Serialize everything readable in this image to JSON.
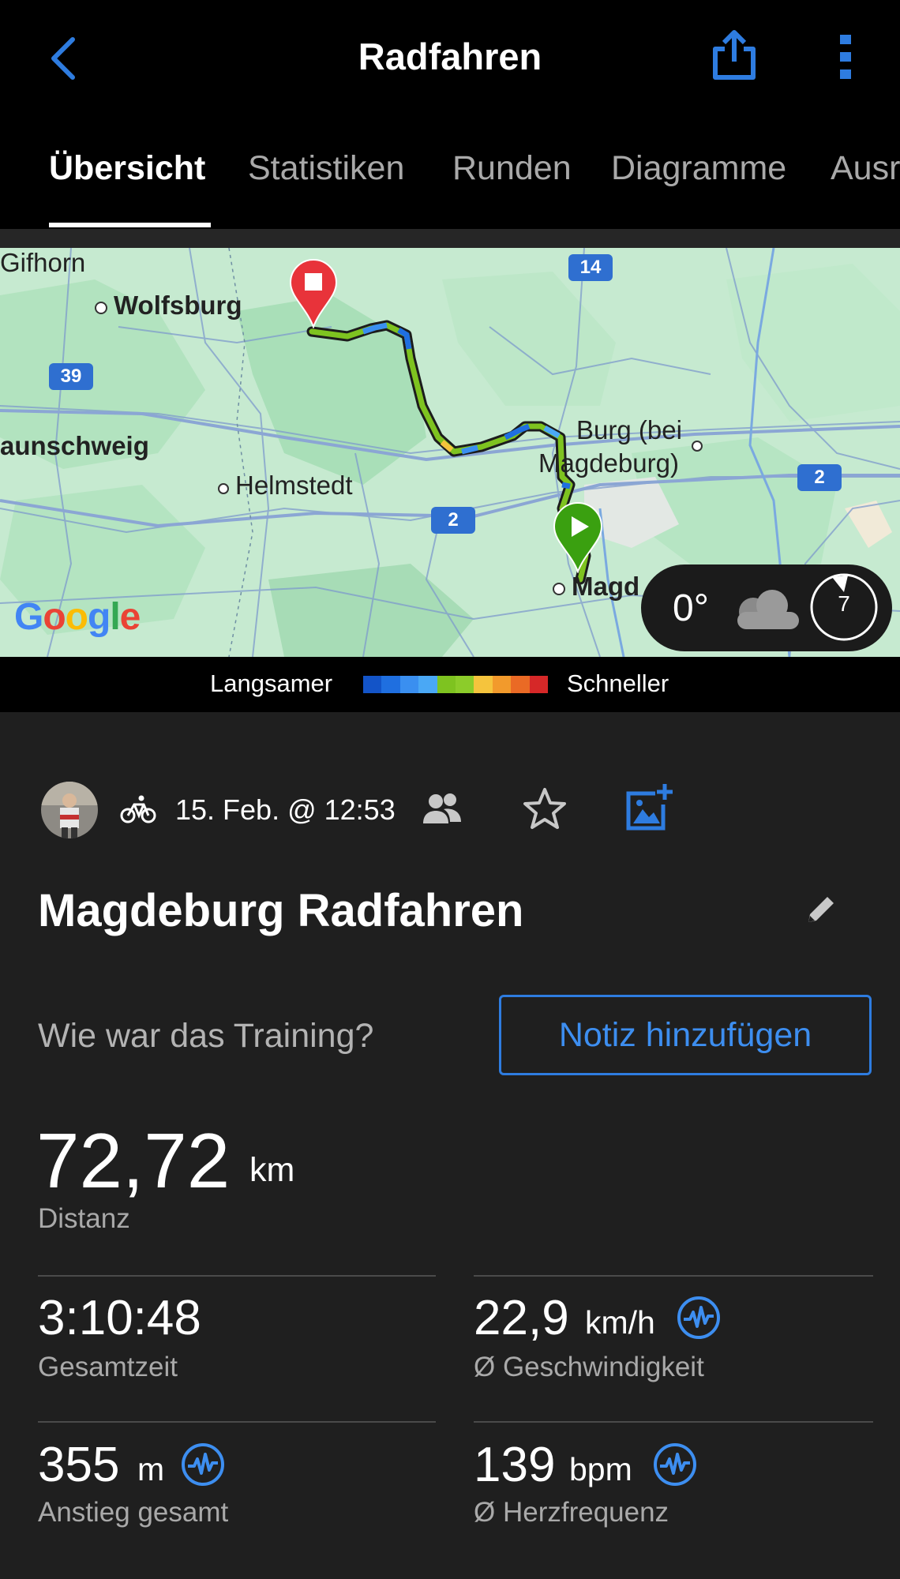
{
  "header": {
    "title": "Radfahren",
    "back_icon": "chevron-left-icon",
    "share_icon": "share-icon",
    "more_icon": "more-vertical-icon",
    "accent": "#2e7ce0"
  },
  "tabs": [
    {
      "label": "Übersicht",
      "active": true
    },
    {
      "label": "Statistiken",
      "active": false
    },
    {
      "label": "Runden",
      "active": false
    },
    {
      "label": "Diagramme",
      "active": false
    },
    {
      "label": "Ausr",
      "active": false
    }
  ],
  "map": {
    "labels": {
      "gifhorn": "Gifhorn",
      "wolfsburg": "Wolfsburg",
      "braunschweig": "aunschweig",
      "helmstedt": "Helmstedt",
      "burg1": "Burg (bei",
      "burg2": "Magdeburg)",
      "magdeburg": "Magd"
    },
    "road_shields": {
      "a14": "14",
      "a39": "39",
      "a2_left": "2",
      "a2_right": "2"
    },
    "provider": "Google",
    "weather": {
      "temperature": "0°",
      "icon": "cloud-icon",
      "wind": "7"
    }
  },
  "legend": {
    "slow": "Langsamer",
    "fast": "Schneller",
    "colors": [
      "#1354c8",
      "#1f6fe0",
      "#3a8ff0",
      "#4aa8f5",
      "#7ec320",
      "#8ccc2a",
      "#f5c43d",
      "#f29a2c",
      "#ea6a25",
      "#d62828"
    ]
  },
  "meta": {
    "date": "15. Feb. @ 12:53",
    "activity_icon": "bicycle-icon",
    "people_icon": "people-icon",
    "star_icon": "star-icon",
    "photo_icon": "add-photo-icon"
  },
  "activity": {
    "title": "Magdeburg Radfahren",
    "question": "Wie war das Training?",
    "note_button": "Notiz hinzufügen"
  },
  "distance": {
    "value": "72,72",
    "unit": "km",
    "label": "Distanz"
  },
  "stats": [
    {
      "value": "3:10:48",
      "unit": "",
      "label": "Gesamtzeit",
      "icon": false
    },
    {
      "value": "22,9",
      "unit": "km/h",
      "label": "Ø Geschwindigkeit",
      "icon": true
    },
    {
      "value": "355",
      "unit": "m",
      "label": "Anstieg gesamt",
      "icon": true
    },
    {
      "value": "139",
      "unit": "bpm",
      "label": "Ø Herzfrequenz",
      "icon": true
    }
  ]
}
